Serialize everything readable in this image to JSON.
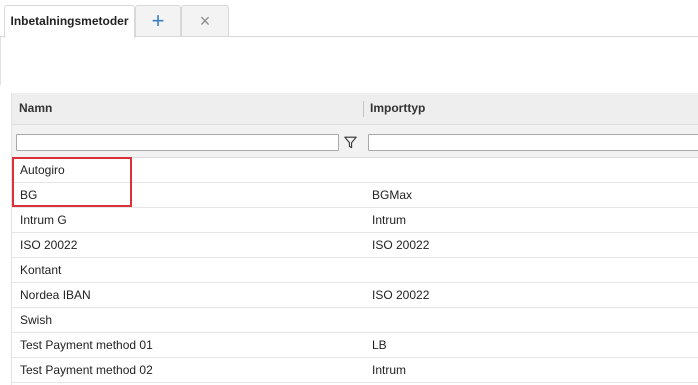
{
  "tabs": {
    "active_label": "Inbetalningsmetoder",
    "add_icon": "+",
    "close_icon": "×"
  },
  "grid": {
    "columns": [
      "Namn",
      "Importtyp"
    ],
    "filter": {
      "name_value": "",
      "import_value": ""
    },
    "rows": [
      {
        "name": "Autogiro",
        "import": ""
      },
      {
        "name": "BG",
        "import": "BGMax"
      },
      {
        "name": "Intrum G",
        "import": "Intrum"
      },
      {
        "name": "ISO 20022",
        "import": "ISO 20022"
      },
      {
        "name": "Kontant",
        "import": ""
      },
      {
        "name": "Nordea IBAN",
        "import": "ISO 20022"
      },
      {
        "name": "Swish",
        "import": ""
      },
      {
        "name": "Test Payment method 01",
        "import": "LB"
      },
      {
        "name": "Test Payment method 02",
        "import": "Intrum"
      }
    ]
  },
  "colors": {
    "add_icon": "#3a7fc1",
    "highlight": "#d9323a",
    "header_bg": "#eeeeee"
  },
  "icons": [
    "plus-icon",
    "close-icon",
    "filter-icon"
  ]
}
